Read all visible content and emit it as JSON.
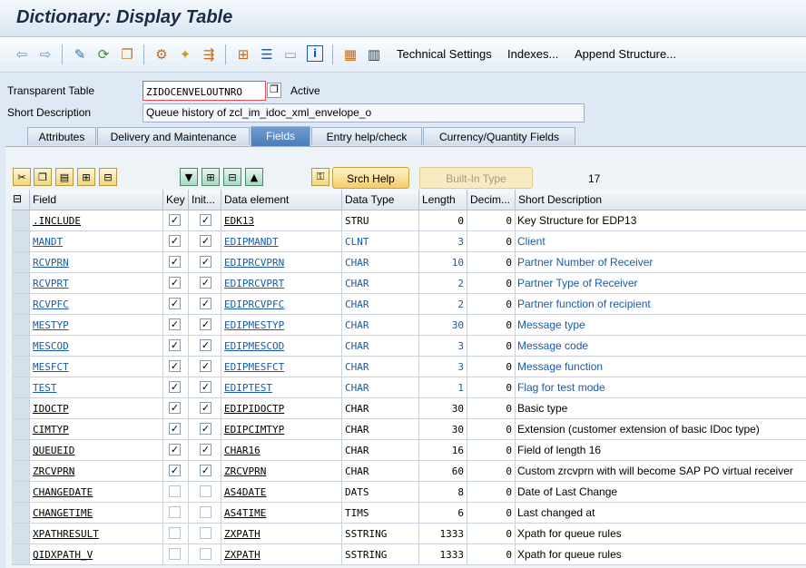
{
  "window": {
    "title": "Dictionary: Display Table"
  },
  "toolbar": {
    "icons": [
      "back-icon",
      "forward-icon",
      "display-change-icon",
      "active-inactive-icon",
      "other-object-icon",
      "check-icon",
      "activate-icon",
      "where-used-icon",
      "hierarchy-icon",
      "object-list-icon",
      "display-object-list-icon",
      "info-icon",
      "graphic-icon",
      "contents-icon"
    ],
    "technical_settings": "Technical Settings",
    "indexes": "Indexes...",
    "append_structure": "Append Structure..."
  },
  "header": {
    "table_label": "Transparent Table",
    "table_name": "ZIDOCENVELOUTNRO",
    "status": "Active",
    "short_desc_label": "Short Description",
    "short_desc": "Queue history of zcl_im_idoc_xml_envelope_o"
  },
  "tabs": [
    "Attributes",
    "Delivery and Maintenance",
    "Fields",
    "Entry help/check",
    "Currency/Quantity Fields"
  ],
  "active_tab": "Fields",
  "field_toolbar": {
    "srch_help": "Srch Help",
    "builtin_type": "Built-In Type",
    "count": "17"
  },
  "columns": [
    "Field",
    "Key",
    "Init...",
    "Data element",
    "Data Type",
    "Length",
    "Decim...",
    "Short Description"
  ],
  "rows": [
    {
      "field": ".INCLUDE",
      "key": true,
      "init": true,
      "de": "EDK13",
      "dtype": "STRU",
      "len": "0",
      "dec": "0",
      "desc": "Key Structure for EDP13",
      "link": false
    },
    {
      "field": "MANDT",
      "key": true,
      "init": true,
      "de": "EDIPMANDT",
      "dtype": "CLNT",
      "len": "3",
      "dec": "0",
      "desc": "Client",
      "link": true
    },
    {
      "field": "RCVPRN",
      "key": true,
      "init": true,
      "de": "EDIPRCVPRN",
      "dtype": "CHAR",
      "len": "10",
      "dec": "0",
      "desc": "Partner Number of Receiver",
      "link": true
    },
    {
      "field": "RCVPRT",
      "key": true,
      "init": true,
      "de": "EDIPRCVPRT",
      "dtype": "CHAR",
      "len": "2",
      "dec": "0",
      "desc": "Partner Type of Receiver",
      "link": true
    },
    {
      "field": "RCVPFC",
      "key": true,
      "init": true,
      "de": "EDIPRCVPFC",
      "dtype": "CHAR",
      "len": "2",
      "dec": "0",
      "desc": "Partner function of recipient",
      "link": true
    },
    {
      "field": "MESTYP",
      "key": true,
      "init": true,
      "de": "EDIPMESTYP",
      "dtype": "CHAR",
      "len": "30",
      "dec": "0",
      "desc": "Message type",
      "link": true
    },
    {
      "field": "MESCOD",
      "key": true,
      "init": true,
      "de": "EDIPMESCOD",
      "dtype": "CHAR",
      "len": "3",
      "dec": "0",
      "desc": "Message code",
      "link": true
    },
    {
      "field": "MESFCT",
      "key": true,
      "init": true,
      "de": "EDIPMESFCT",
      "dtype": "CHAR",
      "len": "3",
      "dec": "0",
      "desc": "Message function",
      "link": true
    },
    {
      "field": "TEST",
      "key": true,
      "init": true,
      "de": "EDIPTEST",
      "dtype": "CHAR",
      "len": "1",
      "dec": "0",
      "desc": "Flag for test mode",
      "link": true
    },
    {
      "field": "IDOCTP",
      "key": true,
      "init": true,
      "de": "EDIPIDOCTP",
      "dtype": "CHAR",
      "len": "30",
      "dec": "0",
      "desc": "Basic type",
      "link": false
    },
    {
      "field": "CIMTYP",
      "key": true,
      "init": true,
      "de": "EDIPCIMTYP",
      "dtype": "CHAR",
      "len": "30",
      "dec": "0",
      "desc": "Extension (customer extension of basic IDoc type)",
      "link": false
    },
    {
      "field": "QUEUEID",
      "key": true,
      "init": true,
      "de": "CHAR16",
      "dtype": "CHAR",
      "len": "16",
      "dec": "0",
      "desc": "Field of length 16",
      "link": false
    },
    {
      "field": "ZRCVPRN",
      "key": true,
      "init": true,
      "de": "ZRCVPRN",
      "dtype": "CHAR",
      "len": "60",
      "dec": "0",
      "desc": "Custom zrcvprn with will become SAP PO virtual receiver",
      "link": false
    },
    {
      "field": "CHANGEDATE",
      "key": false,
      "init": false,
      "de": "AS4DATE",
      "dtype": "DATS",
      "len": "8",
      "dec": "0",
      "desc": "Date of Last Change",
      "link": false
    },
    {
      "field": "CHANGETIME",
      "key": false,
      "init": false,
      "de": "AS4TIME",
      "dtype": "TIMS",
      "len": "6",
      "dec": "0",
      "desc": "Last changed at",
      "link": false
    },
    {
      "field": "XPATHRESULT",
      "key": false,
      "init": false,
      "de": "ZXPATH",
      "dtype": "SSTRING",
      "len": "1333",
      "dec": "0",
      "desc": "Xpath for queue rules",
      "link": false
    },
    {
      "field": "QIDXPATH_V",
      "key": false,
      "init": false,
      "de": "ZXPATH",
      "dtype": "SSTRING",
      "len": "1333",
      "dec": "0",
      "desc": "Xpath for queue rules",
      "link": false
    }
  ]
}
